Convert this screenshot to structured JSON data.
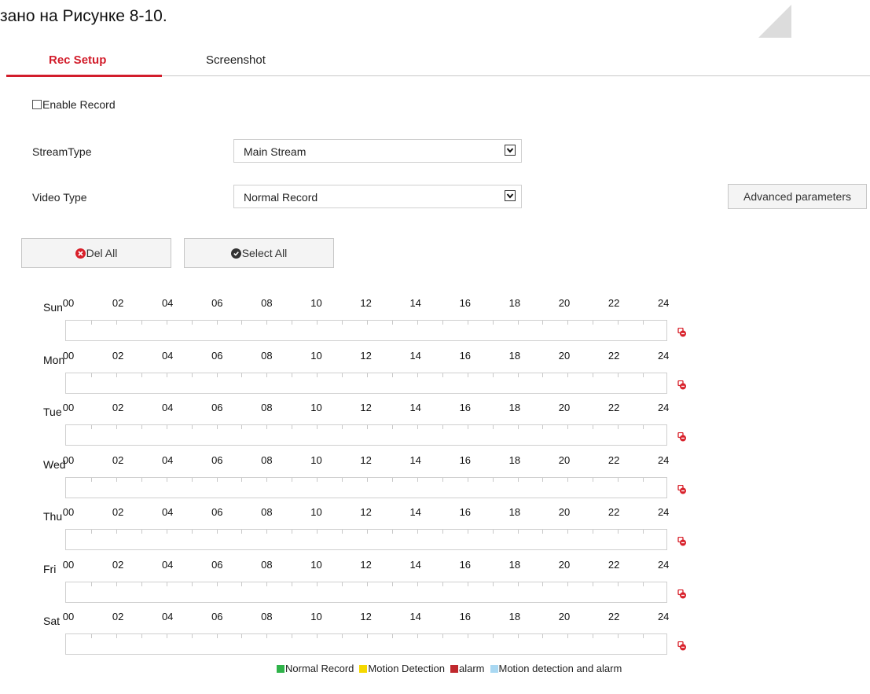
{
  "document_text": "зано на Рисунке 8-10.",
  "tabs": [
    {
      "label": "Rec Setup",
      "active": true
    },
    {
      "label": "Screenshot",
      "active": false
    }
  ],
  "enable_record": {
    "label": "Enable Record",
    "checked": false
  },
  "stream_type": {
    "label": "StreamType",
    "value": "Main Stream"
  },
  "video_type": {
    "label": "Video Type",
    "value": "Normal Record"
  },
  "advanced_button": "Advanced parameters",
  "del_all_button": "Del All",
  "select_all_button": "Select All",
  "hours": [
    "00",
    "02",
    "04",
    "06",
    "08",
    "10",
    "12",
    "14",
    "16",
    "18",
    "20",
    "22",
    "24"
  ],
  "days": [
    "Sun",
    "Mon",
    "Tue",
    "Wed",
    "Thu",
    "Fri",
    "Sat"
  ],
  "legend": [
    {
      "label": "Normal Record",
      "color": "#2fb34a"
    },
    {
      "label": "Motion Detection",
      "color": "#f5d800"
    },
    {
      "label": "alarm",
      "color": "#c0282d"
    },
    {
      "label": "Motion detection and alarm",
      "color": "#a9d8f2"
    }
  ],
  "colors": {
    "accent": "#d21d2b",
    "delete_icon": "#d8202a",
    "select_icon": "#333333"
  },
  "icons": {
    "delete": "x-circle-icon",
    "select": "check-circle-icon",
    "clear": "clear-schedule-icon",
    "dropdown": "chevron-down-icon"
  }
}
